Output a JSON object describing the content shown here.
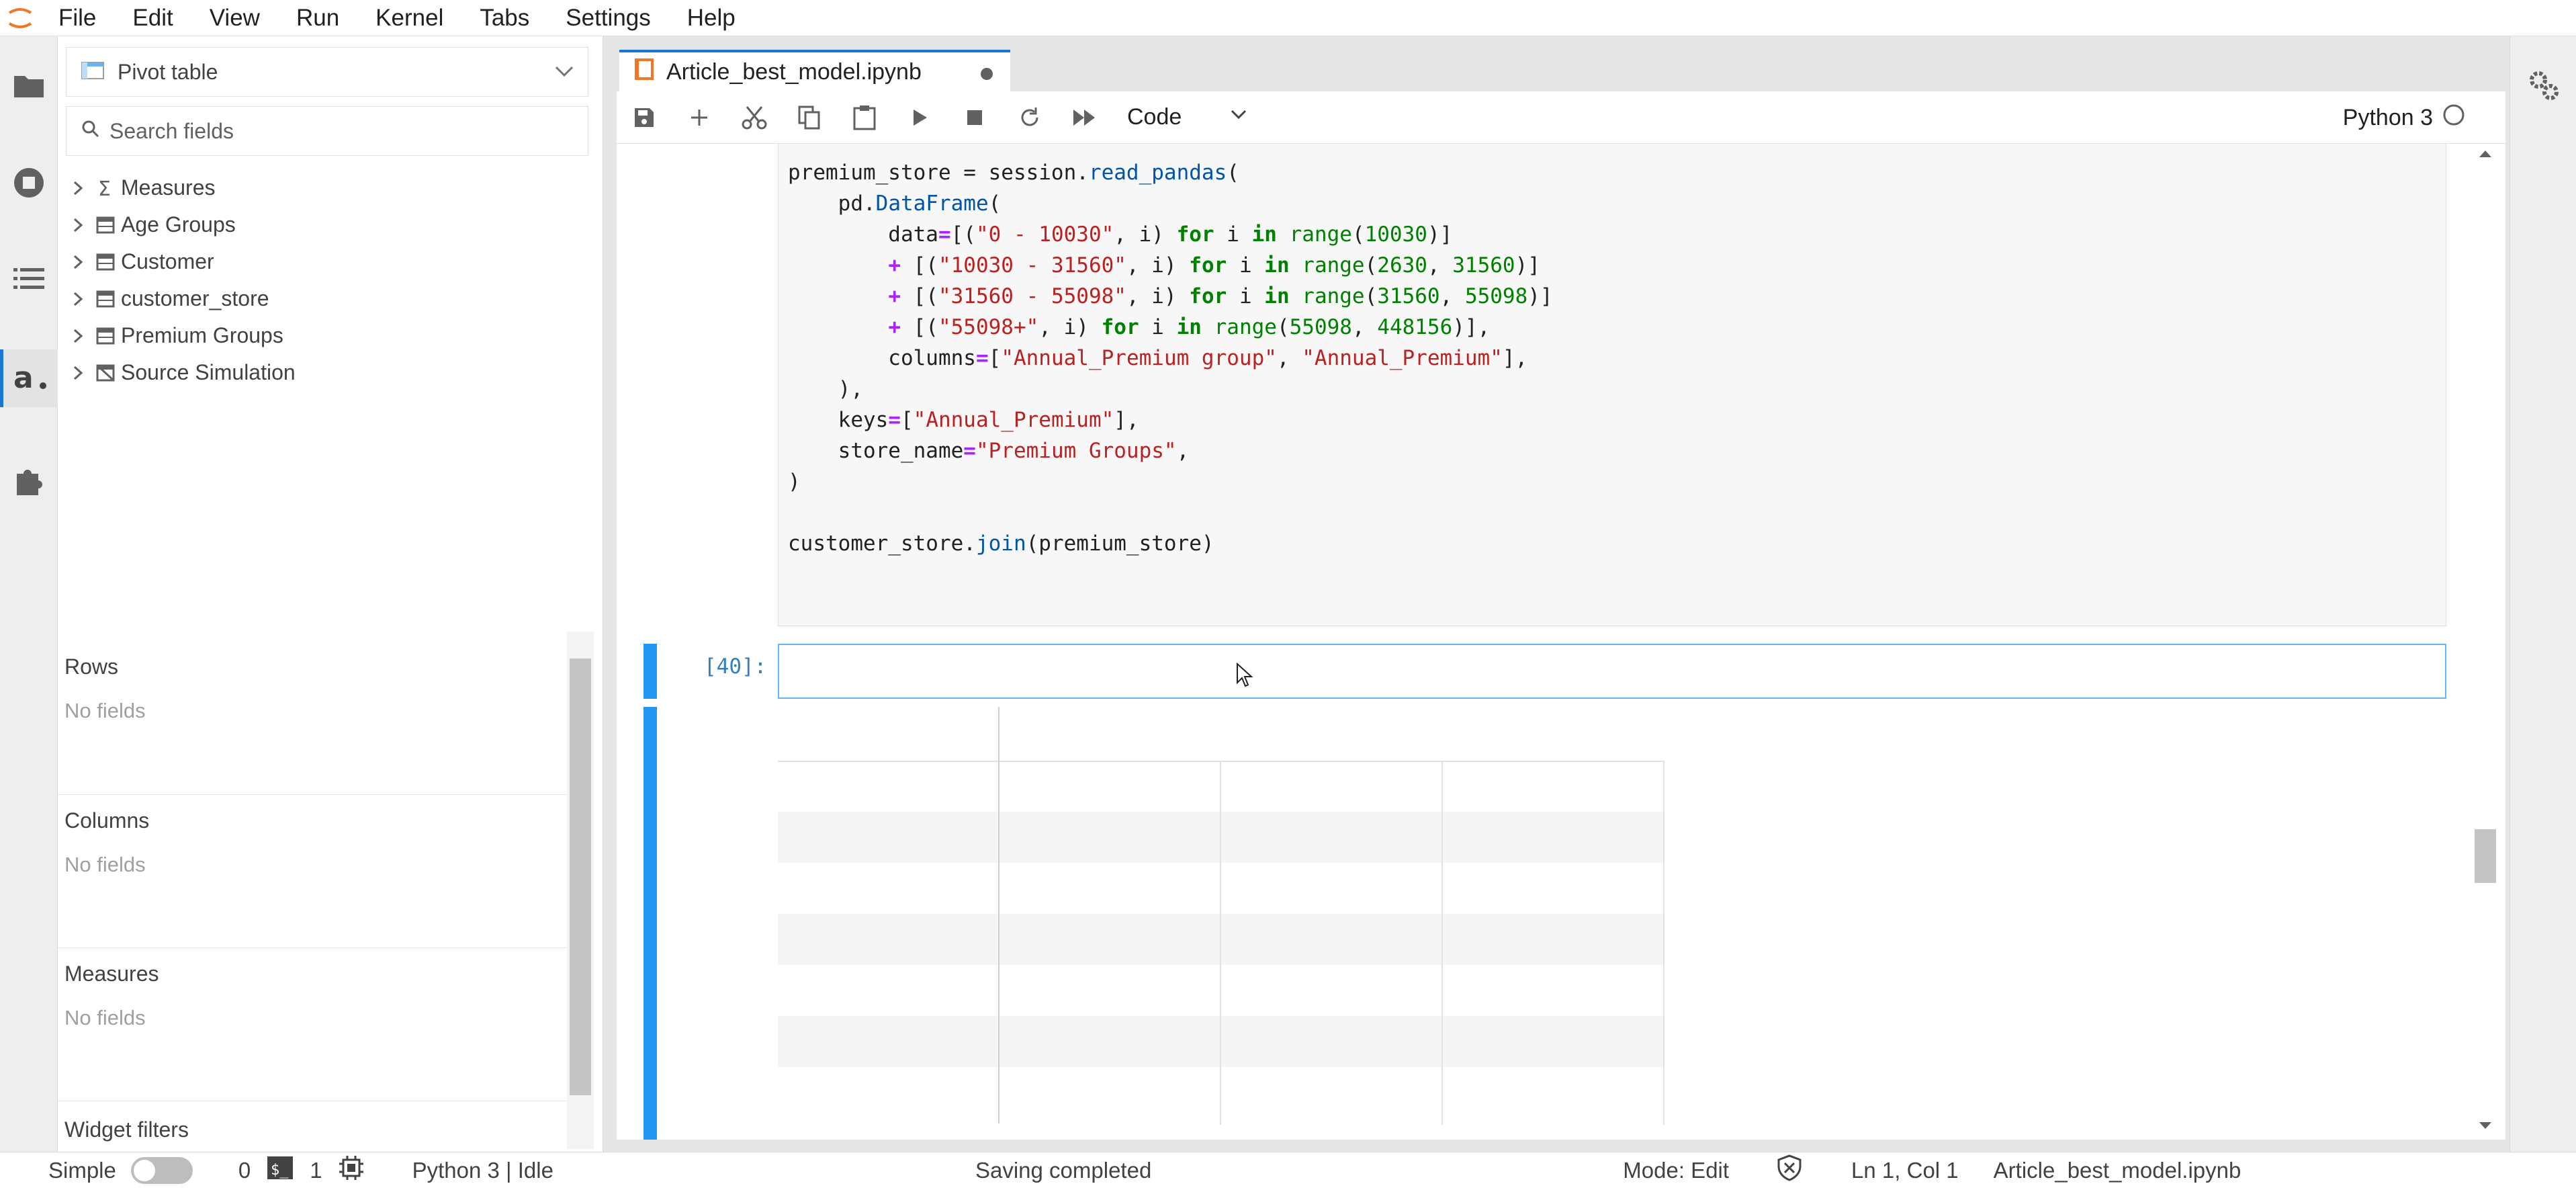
{
  "menubar": {
    "items": [
      "File",
      "Edit",
      "View",
      "Run",
      "Kernel",
      "Tabs",
      "Settings",
      "Help"
    ]
  },
  "sidebar": {
    "widget_select": "Pivot table",
    "search_placeholder": "Search fields",
    "tree": [
      {
        "label": "Measures",
        "icon": "sigma-icon"
      },
      {
        "label": "Age Groups",
        "icon": "table-icon"
      },
      {
        "label": "Customer",
        "icon": "table-icon"
      },
      {
        "label": "customer_store",
        "icon": "table-icon"
      },
      {
        "label": "Premium Groups",
        "icon": "table-icon"
      },
      {
        "label": "Source Simulation",
        "icon": "simulation-icon"
      }
    ],
    "sections": [
      {
        "title": "Rows",
        "empty": "No fields"
      },
      {
        "title": "Columns",
        "empty": "No fields"
      },
      {
        "title": "Measures",
        "empty": "No fields"
      },
      {
        "title": "Widget filters"
      }
    ]
  },
  "tab": {
    "title": "Article_best_model.ipynb"
  },
  "toolbar": {
    "cell_type": "Code",
    "kernel": "Python 3"
  },
  "cells": {
    "active_prompt": "[40]:"
  },
  "statusbar": {
    "mode_label": "Simple",
    "terminals": "0",
    "kernels": "1",
    "kernel_status": "Python 3 | Idle",
    "saving": "Saving completed",
    "mode": "Mode: Edit",
    "position": "Ln 1, Col 1",
    "file": "Article_best_model.ipynb"
  },
  "colors": {
    "accent": "#1976d2",
    "active_cell": "#2196f3"
  }
}
